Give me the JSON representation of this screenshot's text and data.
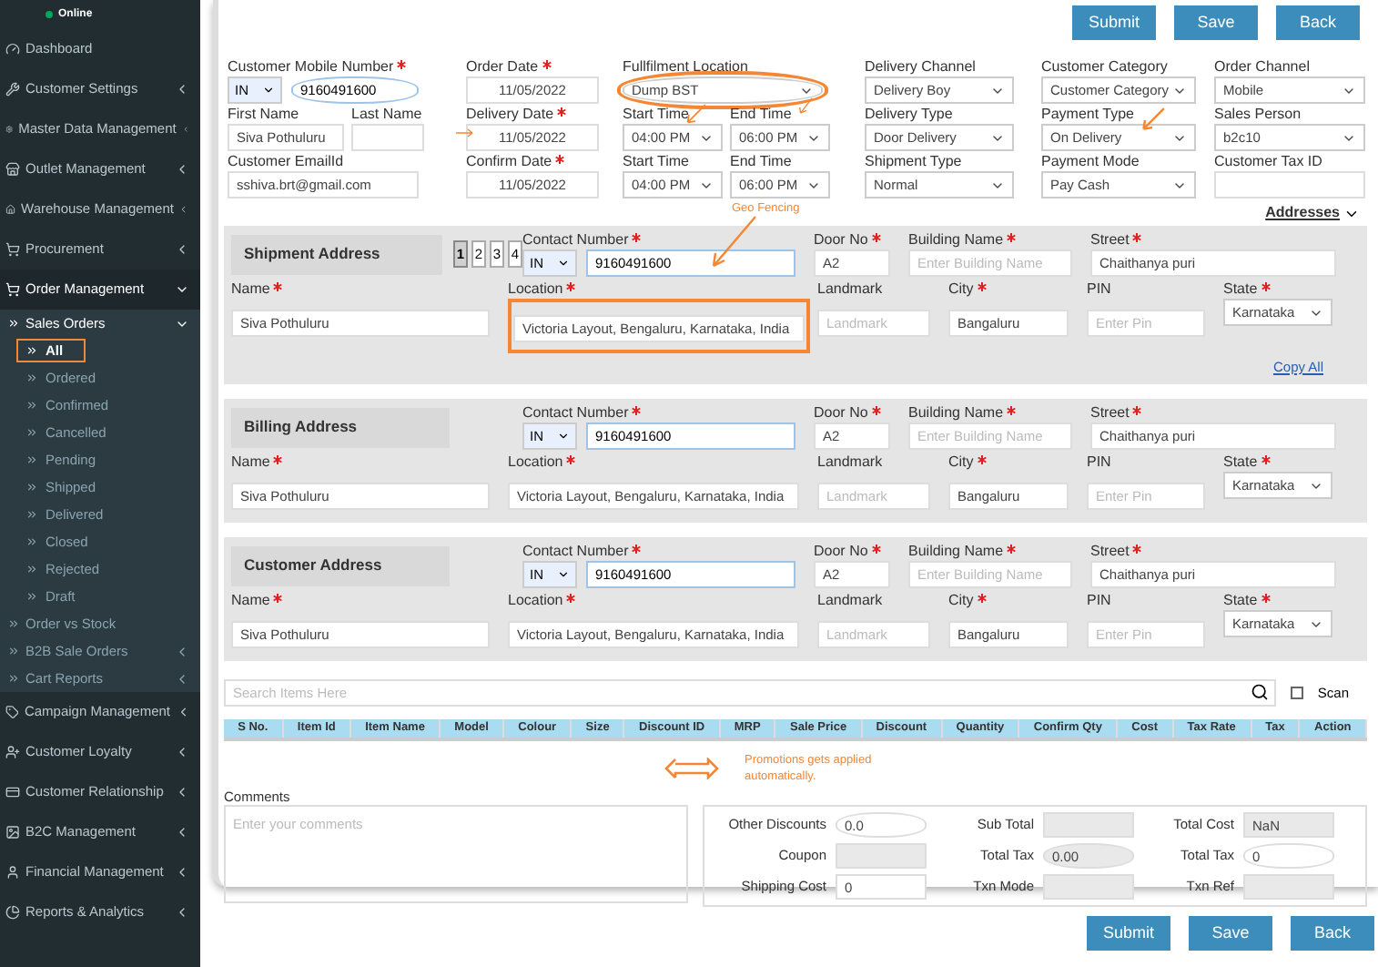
{
  "sidebar": {
    "status": "Online",
    "items": [
      {
        "label": "Dashboard"
      },
      {
        "label": "Customer Settings",
        "expanded": false
      },
      {
        "label": "Master Data Management",
        "expanded": false
      },
      {
        "label": "Outlet Management",
        "expanded": false
      },
      {
        "label": "Warehouse Management",
        "expanded": false
      },
      {
        "label": "Procurement",
        "expanded": false
      },
      {
        "label": "Order Management",
        "expanded": true,
        "children": [
          {
            "label": "Sales Orders",
            "expanded": true,
            "children": [
              {
                "label": "All",
                "selected": true
              },
              {
                "label": "Ordered",
                "selected": false
              },
              {
                "label": "Confirmed",
                "selected": false
              },
              {
                "label": "Cancelled",
                "selected": false
              },
              {
                "label": "Pending",
                "selected": false
              },
              {
                "label": "Shipped",
                "selected": false
              },
              {
                "label": "Delivered",
                "selected": false
              },
              {
                "label": "Closed",
                "selected": false
              },
              {
                "label": "Rejected",
                "selected": false
              },
              {
                "label": "Draft",
                "selected": false
              }
            ]
          },
          {
            "label": "Order vs Stock"
          },
          {
            "label": "B2B Sale Orders",
            "expanded": false
          },
          {
            "label": "Cart Reports",
            "expanded": false
          }
        ]
      },
      {
        "label": "Campaign Management",
        "expanded": false
      },
      {
        "label": "Customer Loyalty",
        "expanded": false
      },
      {
        "label": "Customer Relationship",
        "expanded": false
      },
      {
        "label": "B2C Management",
        "expanded": false
      },
      {
        "label": "Financial Management",
        "expanded": false
      },
      {
        "label": "Reports & Analytics",
        "expanded": false
      }
    ]
  },
  "header_buttons": [
    "Submit",
    "Save",
    "Back"
  ],
  "order_form": {
    "rows": [
      [
        {
          "fields": [
            {
              "label": "Customer Mobile Number",
              "required": true,
              "kind": "phone",
              "code": "IN",
              "value": "9160491600",
              "circled": true
            }
          ]
        },
        {
          "fields": [
            {
              "label": "Order Date",
              "required": true,
              "kind": "date",
              "value": "11/05/2022"
            }
          ]
        },
        {
          "fields": [
            {
              "label": "Fullfilment Location",
              "kind": "select",
              "value": "Dump BST",
              "circled": true
            }
          ]
        },
        {
          "fields": [
            {
              "label": "Delivery Channel",
              "kind": "select",
              "value": "Delivery Boy"
            }
          ]
        },
        {
          "fields": [
            {
              "label": "Customer Category",
              "kind": "select",
              "value": "Customer Category"
            }
          ]
        },
        {
          "fields": [
            {
              "label": "Order Channel",
              "kind": "select",
              "value": "Mobile"
            }
          ]
        }
      ],
      [
        {
          "fields": [
            {
              "label": "First Name",
              "kind": "text",
              "value": "Siva Pothuluru"
            },
            {
              "label": "Last Name",
              "kind": "text"
            }
          ]
        },
        {
          "fields": [
            {
              "label": "Delivery Date",
              "required": true,
              "kind": "date",
              "value": "11/05/2022"
            }
          ]
        },
        {
          "fields": [
            {
              "label": "Start Time",
              "kind": "select",
              "value": "04:00 PM"
            },
            {
              "label": "End Time",
              "kind": "select",
              "value": "06:00 PM"
            }
          ]
        },
        {
          "fields": [
            {
              "label": "Delivery Type",
              "kind": "select",
              "value": "Door Delivery"
            }
          ]
        },
        {
          "fields": [
            {
              "label": "Payment Type",
              "kind": "select",
              "value": "On Delivery"
            }
          ]
        },
        {
          "fields": [
            {
              "label": "Sales Person",
              "kind": "select",
              "value": "b2c10"
            }
          ]
        }
      ],
      [
        {
          "fields": [
            {
              "label": "Customer EmailId",
              "kind": "text",
              "value": "sshiva.brt@gmail.com"
            }
          ]
        },
        {
          "fields": [
            {
              "label": "Confirm Date",
              "required": true,
              "kind": "date",
              "value": "11/05/2022"
            }
          ]
        },
        {
          "fields": [
            {
              "label": "Start Time",
              "kind": "select",
              "value": "04:00 PM"
            },
            {
              "label": "End Time",
              "kind": "select",
              "value": "06:00 PM"
            }
          ]
        },
        {
          "fields": [
            {
              "label": "Shipment Type",
              "kind": "select",
              "value": "Normal"
            }
          ]
        },
        {
          "fields": [
            {
              "label": "Payment Mode",
              "kind": "select",
              "value": "Pay Cash"
            }
          ]
        },
        {
          "fields": [
            {
              "label": "Customer Tax ID",
              "kind": "text"
            }
          ]
        }
      ]
    ]
  },
  "addresses": {
    "link": "Addresses",
    "sections": [
      {
        "title": "Shipment Address",
        "pages": [
          {
            "label": "1",
            "selected": true
          },
          {
            "label": "2",
            "selected": false
          },
          {
            "label": "3",
            "selected": false
          },
          {
            "label": "4",
            "selected": false
          }
        ],
        "annotation": "Geo Fencing",
        "copy_link": "Copy All",
        "top": [
          {
            "label": "Contact Number",
            "required": true,
            "kind": "phone",
            "code": "IN",
            "value": "9160491600"
          },
          {
            "label": "Door No",
            "required": true,
            "kind": "text",
            "value": "A2"
          },
          {
            "label": "Building Name",
            "required": true,
            "kind": "text",
            "placeholder": "Enter Building Name"
          },
          {
            "label": "Street",
            "required": true,
            "kind": "text",
            "value": "Chaithanya puri"
          }
        ],
        "bottom": [
          {
            "label": "Name",
            "required": true,
            "kind": "text",
            "value": "Siva Pothuluru"
          },
          {
            "label": "Location",
            "required": true,
            "kind": "text",
            "value": "Victoria Layout, Bengaluru, Karnataka, India",
            "boxed": true
          },
          {
            "label": "Landmark",
            "kind": "text",
            "placeholder": "Landmark"
          },
          {
            "label": "City",
            "required": true,
            "kind": "text",
            "value": "Bangaluru"
          },
          {
            "label": "PIN",
            "kind": "text",
            "placeholder": "Enter Pin"
          },
          {
            "label": "State",
            "required": true,
            "kind": "select",
            "value": "Karnataka"
          }
        ]
      },
      {
        "title": "Billing Address",
        "top": [
          {
            "label": "Contact Number",
            "required": true,
            "kind": "phone",
            "code": "IN",
            "value": "9160491600"
          },
          {
            "label": "Door No",
            "required": true,
            "kind": "text",
            "value": "A2"
          },
          {
            "label": "Building Name",
            "required": true,
            "kind": "text",
            "placeholder": "Enter Building Name"
          },
          {
            "label": "Street",
            "required": true,
            "kind": "text",
            "value": "Chaithanya puri"
          }
        ],
        "bottom": [
          {
            "label": "Name",
            "required": true,
            "kind": "text",
            "value": "Siva Pothuluru"
          },
          {
            "label": "Location",
            "required": true,
            "kind": "text",
            "value": "Victoria Layout, Bengaluru, Karnataka, India"
          },
          {
            "label": "Landmark",
            "kind": "text",
            "placeholder": "Landmark"
          },
          {
            "label": "City",
            "required": true,
            "kind": "text",
            "value": "Bangaluru"
          },
          {
            "label": "PIN",
            "kind": "text",
            "placeholder": "Enter Pin"
          },
          {
            "label": "State",
            "required": true,
            "kind": "select",
            "value": "Karnataka"
          }
        ]
      },
      {
        "title": "Customer Address",
        "top": [
          {
            "label": "Contact Number",
            "required": true,
            "kind": "phone",
            "code": "IN",
            "value": "9160491600"
          },
          {
            "label": "Door No",
            "required": true,
            "kind": "text",
            "value": "A2"
          },
          {
            "label": "Building Name",
            "required": true,
            "kind": "text",
            "placeholder": "Enter Building Name"
          },
          {
            "label": "Street",
            "required": true,
            "kind": "text",
            "value": "Chaithanya puri"
          }
        ],
        "bottom": [
          {
            "label": "Name",
            "required": true,
            "kind": "text",
            "value": "Siva Pothuluru"
          },
          {
            "label": "Location",
            "required": true,
            "kind": "text",
            "value": "Victoria Layout, Bengaluru, Karnataka, India"
          },
          {
            "label": "Landmark",
            "kind": "text",
            "placeholder": "Landmark"
          },
          {
            "label": "City",
            "required": true,
            "kind": "text",
            "value": "Bangaluru"
          },
          {
            "label": "PIN",
            "kind": "text",
            "placeholder": "Enter Pin"
          },
          {
            "label": "State",
            "required": true,
            "kind": "select",
            "value": "Karnataka"
          }
        ]
      }
    ]
  },
  "items": {
    "search_placeholder": "Search Items Here",
    "scan": {
      "label": "Scan",
      "checked": false
    },
    "columns": [
      "S No.",
      "Item Id",
      "Item Name",
      "Model",
      "Colour",
      "Size",
      "Discount ID",
      "MRP",
      "Sale Price",
      "Discount",
      "Quantity",
      "Confirm Qty",
      "Cost",
      "Tax Rate",
      "Tax",
      "Action"
    ],
    "annotation": "Promotions gets applied automatically."
  },
  "comments": {
    "label": "Comments",
    "placeholder": "Enter your comments"
  },
  "totals": [
    [
      {
        "label": "Other Discounts",
        "value": "0.0",
        "disabled": false,
        "circled": true
      },
      {
        "label": "Sub Total",
        "disabled": true
      },
      {
        "label": "Total Cost",
        "value": "NaN",
        "disabled": true
      }
    ],
    [
      {
        "label": "Coupon",
        "disabled": true
      },
      {
        "label": "Total Tax",
        "value": "0.00",
        "disabled": true,
        "circled": true
      },
      {
        "label": "Total Tax",
        "value": "0",
        "disabled": false,
        "circled": true
      }
    ],
    [
      {
        "label": "Shipping Cost",
        "value": "0",
        "disabled": false
      },
      {
        "label": "Txn Mode",
        "disabled": true
      },
      {
        "label": "Txn Ref",
        "disabled": true
      }
    ]
  ],
  "footer_buttons": [
    "Submit",
    "Save",
    "Back"
  ]
}
